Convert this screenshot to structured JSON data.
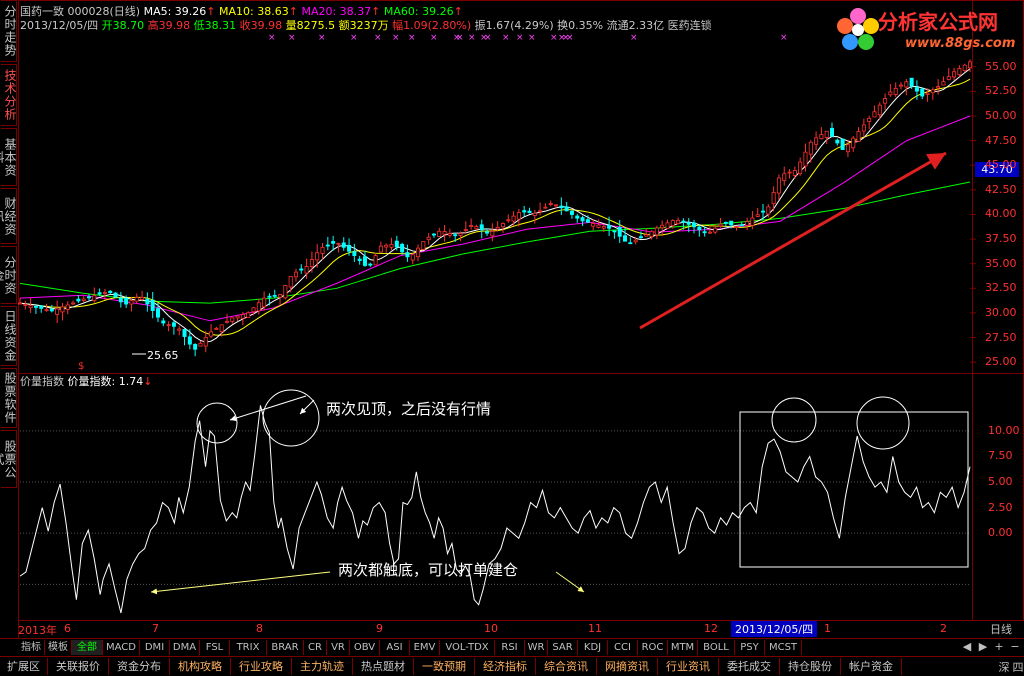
{
  "left_tabs": [
    {
      "label": "分时走势",
      "active": false
    },
    {
      "label": "技术分析",
      "active": true
    },
    {
      "label": "基本资料",
      "active": false
    },
    {
      "label": "财经资讯",
      "active": false
    },
    {
      "label": "分时资金",
      "active": false
    },
    {
      "label": "日线资金",
      "active": false
    },
    {
      "label": "股票软件",
      "active": false
    },
    {
      "label": "股票公式",
      "active": false
    }
  ],
  "header": {
    "stock": "国药一致 000028(日线)",
    "ma5": "MA5: 39.26",
    "ma10": "MA10: 38.63",
    "ma20": "MA20: 38.37",
    "ma60": "MA60: 39.26",
    "date": "2013/12/05/四",
    "open": "开38.70",
    "high": "高39.98",
    "low": "低38.31",
    "close": "收39.98",
    "volume": "量8275.5",
    "amount": "额3237万",
    "change": "幅1.09(2.80%)",
    "amplitude": "振1.67(4.29%)",
    "turnover": "换0.35%",
    "float_cap": "流通2.33亿",
    "sector": "医药连锁"
  },
  "logo": {
    "text": "分析家公式网",
    "url": "www.88gs.com"
  },
  "price_axis": [
    "55.00",
    "52.50",
    "50.00",
    "47.50",
    "45.00",
    "42.50",
    "40.00",
    "37.50",
    "35.00",
    "32.50",
    "30.00",
    "27.50",
    "25.00"
  ],
  "price_tag": "43.70",
  "low_marker": "25.65",
  "indicator": {
    "name": "价量指数",
    "value_label": "价量指数: 1.74"
  },
  "ind_axis": [
    "10.00",
    "7.50",
    "5.00",
    "2.50",
    "0.00"
  ],
  "annotations": {
    "top": "两次见顶，之后没有行情",
    "bottom": "两次都触底，可以打单建仓"
  },
  "x_axis": {
    "labels": [
      "2013年",
      "6",
      "7",
      "8",
      "9",
      "10",
      "11",
      "12",
      "1",
      "2"
    ],
    "cursor_date": "2013/12/05/四",
    "period": "日线"
  },
  "indicator_tabs": [
    "指标",
    "模板",
    "全部",
    "MACD",
    "DMI",
    "DMA",
    "FSL",
    "TRIX",
    "BRAR",
    "CR",
    "VR",
    "OBV",
    "ASI",
    "EMV",
    "VOL-TDX",
    "RSI",
    "WR",
    "SAR",
    "KDJ",
    "CCI",
    "ROC",
    "MTM",
    "BOLL",
    "PSY",
    "MCST"
  ],
  "function_tabs": [
    "扩展区",
    "关联报价",
    "资金分布",
    "机构攻略",
    "行业攻略",
    "主力轨迹",
    "热点题材",
    "一致预期",
    "经济指标",
    "综合资讯",
    "网摘资讯",
    "行业资讯",
    "委托成交",
    "持仓股份",
    "帐户资金"
  ],
  "nav_buttons": [
    "▲",
    "▼",
    "+",
    "−",
    "深",
    "四"
  ],
  "colors": {
    "up": "#ff3030",
    "down": "#00ffff",
    "ma5": "#ffffff",
    "ma10": "#ffff00",
    "ma20": "#ff00ff",
    "ma60": "#00ff00",
    "frame": "#7a0000"
  },
  "chart_data": {
    "price_range": [
      24.0,
      56.5
    ],
    "ind_range": [
      -8.0,
      14.0
    ],
    "n_candles": 180,
    "price_waypoints": [
      [
        0,
        31.0
      ],
      [
        10,
        30.2
      ],
      [
        20,
        31.4
      ],
      [
        28,
        32.2
      ],
      [
        33,
        30.8
      ],
      [
        38,
        31.8
      ],
      [
        45,
        29.0
      ],
      [
        50,
        28.5
      ],
      [
        55,
        26.2
      ],
      [
        60,
        28.0
      ],
      [
        67,
        29.5
      ],
      [
        72,
        30.0
      ],
      [
        77,
        31.5
      ],
      [
        82,
        31.8
      ],
      [
        86,
        34.0
      ],
      [
        90,
        34.5
      ],
      [
        95,
        36.6
      ],
      [
        100,
        37.2
      ],
      [
        105,
        36.0
      ],
      [
        110,
        34.5
      ],
      [
        114,
        36.8
      ],
      [
        118,
        37.0
      ],
      [
        123,
        35.5
      ],
      [
        128,
        37.5
      ],
      [
        133,
        38.4
      ],
      [
        138,
        37.8
      ],
      [
        143,
        39.0
      ],
      [
        148,
        38.0
      ],
      [
        153,
        39.2
      ],
      [
        158,
        40.3
      ],
      [
        163,
        40.1
      ],
      [
        168,
        41.2
      ],
      [
        172,
        40.5
      ],
      [
        177,
        39.4
      ],
      [
        182,
        39.0
      ],
      [
        187,
        38.5
      ],
      [
        192,
        37.0
      ],
      [
        197,
        37.8
      ],
      [
        202,
        38.8
      ],
      [
        207,
        39.5
      ],
      [
        212,
        38.9
      ],
      [
        217,
        38.0
      ],
      [
        222,
        39.2
      ],
      [
        227,
        38.7
      ],
      [
        232,
        39.8
      ],
      [
        236,
        40.5
      ],
      [
        240,
        44.0
      ],
      [
        245,
        44.5
      ],
      [
        250,
        47.5
      ],
      [
        255,
        48.5
      ],
      [
        260,
        46.5
      ],
      [
        265,
        48.5
      ],
      [
        270,
        50.5
      ],
      [
        275,
        52.5
      ],
      [
        280,
        53.5
      ],
      [
        285,
        52.0
      ],
      [
        290,
        53.0
      ],
      [
        295,
        54.5
      ],
      [
        300,
        55.5
      ]
    ],
    "ma60_waypoints": [
      [
        0,
        33.0
      ],
      [
        20,
        32.0
      ],
      [
        40,
        31.2
      ],
      [
        60,
        31.0
      ],
      [
        80,
        31.5
      ],
      [
        100,
        32.5
      ],
      [
        120,
        34.5
      ],
      [
        140,
        36.0
      ],
      [
        160,
        37.2
      ],
      [
        180,
        38.3
      ],
      [
        200,
        38.6
      ],
      [
        220,
        39.0
      ],
      [
        240,
        39.6
      ],
      [
        260,
        40.6
      ],
      [
        280,
        42.0
      ],
      [
        300,
        43.3
      ]
    ],
    "ma20_waypoints": [
      [
        0,
        31.5
      ],
      [
        20,
        31.8
      ],
      [
        40,
        30.8
      ],
      [
        60,
        29.2
      ],
      [
        80,
        30.5
      ],
      [
        100,
        33.0
      ],
      [
        120,
        35.8
      ],
      [
        140,
        37.0
      ],
      [
        160,
        38.5
      ],
      [
        180,
        39.2
      ],
      [
        200,
        38.2
      ],
      [
        220,
        38.5
      ],
      [
        240,
        39.3
      ],
      [
        260,
        43.2
      ],
      [
        280,
        47.5
      ],
      [
        300,
        50.0
      ]
    ],
    "indicator_points": [
      [
        0,
        -4.2
      ],
      [
        4,
        -3.8
      ],
      [
        8,
        -1.5
      ],
      [
        12,
        0.8
      ],
      [
        15,
        2.5
      ],
      [
        19,
        0.2
      ],
      [
        23,
        3.0
      ],
      [
        27,
        4.8
      ],
      [
        31,
        1.0
      ],
      [
        35,
        -3.5
      ],
      [
        38,
        -6.5
      ],
      [
        42,
        -1.0
      ],
      [
        46,
        0.3
      ],
      [
        50,
        -2.5
      ],
      [
        54,
        -6.0
      ],
      [
        56,
        -4.5
      ],
      [
        60,
        -3.0
      ],
      [
        64,
        -5.5
      ],
      [
        68,
        -7.8
      ],
      [
        72,
        -4.5
      ],
      [
        76,
        -3.0
      ],
      [
        80,
        -2.0
      ],
      [
        84,
        -1.5
      ],
      [
        88,
        0.3
      ],
      [
        92,
        1.0
      ],
      [
        96,
        3.0
      ],
      [
        100,
        2.5
      ],
      [
        104,
        1.0
      ],
      [
        107,
        3.5
      ],
      [
        110,
        2.0
      ],
      [
        114,
        4.5
      ],
      [
        118,
        9.0
      ],
      [
        121,
        11.0
      ],
      [
        125,
        6.5
      ],
      [
        128,
        10.0
      ],
      [
        131,
        9.5
      ],
      [
        135,
        3.2
      ],
      [
        139,
        1.2
      ],
      [
        143,
        2.0
      ],
      [
        146,
        1.5
      ],
      [
        149,
        3.5
      ],
      [
        152,
        5.0
      ],
      [
        155,
        4.2
      ],
      [
        158,
        7.5
      ],
      [
        162,
        12.5
      ],
      [
        165,
        10.8
      ],
      [
        168,
        9.8
      ],
      [
        171,
        3.0
      ],
      [
        174,
        0.5
      ],
      [
        176,
        1.5
      ],
      [
        180,
        -1.5
      ],
      [
        184,
        -3.5
      ],
      [
        188,
        0.5
      ],
      [
        192,
        2.0
      ],
      [
        196,
        3.5
      ],
      [
        200,
        5.0
      ],
      [
        203,
        3.8
      ],
      [
        207,
        1.5
      ],
      [
        211,
        0.5
      ],
      [
        214,
        3.0
      ],
      [
        217,
        4.5
      ],
      [
        220,
        3.2
      ],
      [
        224,
        2.0
      ],
      [
        228,
        -0.5
      ],
      [
        231,
        1.2
      ],
      [
        234,
        0.8
      ],
      [
        238,
        2.5
      ],
      [
        242,
        3.0
      ],
      [
        246,
        2.0
      ],
      [
        249,
        -1.0
      ],
      [
        252,
        -3.0
      ],
      [
        255,
        -2.5
      ],
      [
        258,
        3.0
      ],
      [
        261,
        2.8
      ],
      [
        264,
        3.5
      ],
      [
        267,
        6.0
      ],
      [
        270,
        3.5
      ],
      [
        273,
        2.0
      ],
      [
        276,
        1.0
      ],
      [
        279,
        -0.5
      ],
      [
        282,
        1.5
      ],
      [
        285,
        0.5
      ],
      [
        288,
        -2.0
      ],
      [
        291,
        -1.0
      ],
      [
        294,
        -3.5
      ],
      [
        297,
        -4.0
      ],
      [
        300,
        -3.2
      ],
      [
        303,
        -4.0
      ],
      [
        306,
        -6.5
      ],
      [
        309,
        -7.0
      ],
      [
        312,
        -5.5
      ],
      [
        316,
        -3.0
      ],
      [
        320,
        -2.5
      ],
      [
        324,
        -1.5
      ],
      [
        328,
        0.5
      ],
      [
        332,
        0.0
      ],
      [
        336,
        -0.5
      ],
      [
        340,
        1.0
      ],
      [
        344,
        3.0
      ],
      [
        348,
        2.5
      ],
      [
        352,
        4.2
      ],
      [
        356,
        2.0
      ],
      [
        360,
        1.5
      ],
      [
        364,
        2.5
      ],
      [
        368,
        1.5
      ],
      [
        372,
        0.5
      ],
      [
        376,
        0.0
      ],
      [
        380,
        1.5
      ],
      [
        384,
        2.2
      ],
      [
        388,
        0.5
      ],
      [
        392,
        1.5
      ],
      [
        396,
        1.0
      ],
      [
        400,
        2.5
      ],
      [
        404,
        2.0
      ],
      [
        408,
        0.0
      ],
      [
        412,
        -0.5
      ],
      [
        416,
        1.0
      ],
      [
        420,
        3.0
      ],
      [
        424,
        4.5
      ],
      [
        428,
        5.0
      ],
      [
        432,
        3.0
      ],
      [
        436,
        4.5
      ],
      [
        440,
        1.0
      ],
      [
        444,
        -2.0
      ],
      [
        448,
        -1.5
      ],
      [
        452,
        1.0
      ],
      [
        456,
        2.5
      ],
      [
        460,
        2.0
      ],
      [
        464,
        0.5
      ],
      [
        468,
        0.0
      ],
      [
        472,
        1.5
      ],
      [
        476,
        0.8
      ],
      [
        480,
        2.0
      ],
      [
        484,
        1.5
      ],
      [
        488,
        2.5
      ],
      [
        492,
        3.0
      ],
      [
        496,
        2.0
      ],
      [
        500,
        6.5
      ],
      [
        504,
        8.8
      ],
      [
        508,
        9.2
      ],
      [
        512,
        8.0
      ],
      [
        516,
        6.0
      ],
      [
        520,
        5.5
      ],
      [
        524,
        5.0
      ],
      [
        528,
        6.5
      ],
      [
        532,
        7.5
      ],
      [
        536,
        5.5
      ],
      [
        540,
        5.0
      ],
      [
        544,
        4.0
      ],
      [
        548,
        1.5
      ],
      [
        552,
        -0.5
      ],
      [
        556,
        3.5
      ],
      [
        560,
        6.5
      ],
      [
        564,
        9.5
      ],
      [
        568,
        7.0
      ],
      [
        572,
        5.5
      ],
      [
        576,
        4.5
      ],
      [
        580,
        5.0
      ],
      [
        584,
        4.0
      ],
      [
        588,
        7.5
      ],
      [
        592,
        5.0
      ],
      [
        596,
        4.0
      ],
      [
        600,
        3.5
      ],
      [
        604,
        4.5
      ],
      [
        608,
        2.5
      ],
      [
        612,
        3.0
      ],
      [
        616,
        2.0
      ],
      [
        620,
        4.0
      ],
      [
        624,
        3.5
      ],
      [
        628,
        4.5
      ],
      [
        632,
        2.5
      ],
      [
        636,
        4.0
      ],
      [
        640,
        6.5
      ]
    ]
  }
}
